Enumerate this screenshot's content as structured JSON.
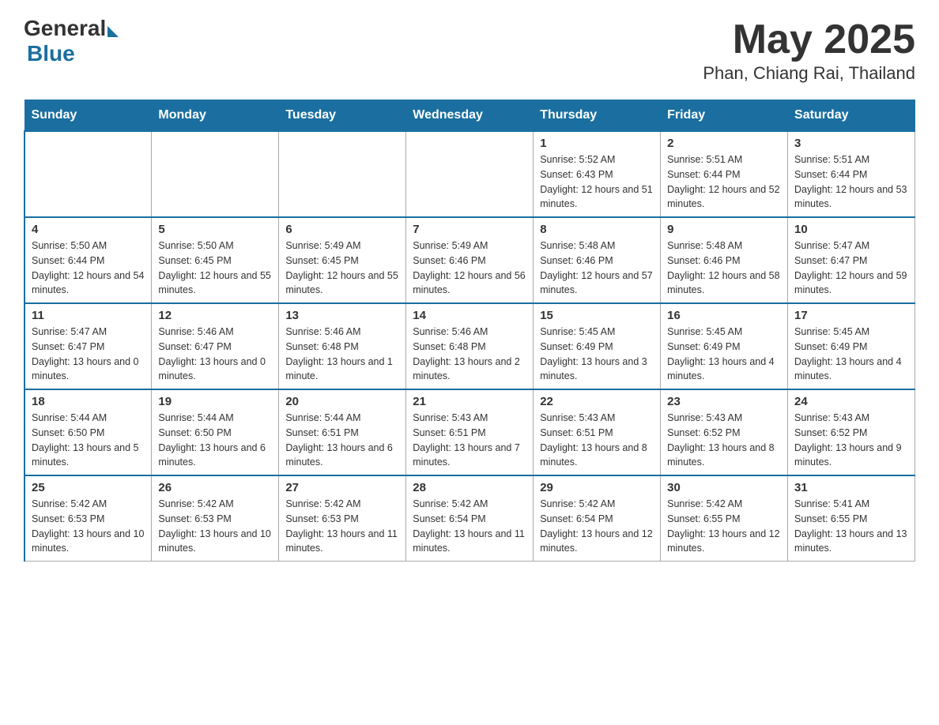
{
  "header": {
    "logo_general": "General",
    "logo_blue": "Blue",
    "month_year": "May 2025",
    "location": "Phan, Chiang Rai, Thailand"
  },
  "days_of_week": [
    "Sunday",
    "Monday",
    "Tuesday",
    "Wednesday",
    "Thursday",
    "Friday",
    "Saturday"
  ],
  "weeks": [
    [
      {
        "day": "",
        "info": ""
      },
      {
        "day": "",
        "info": ""
      },
      {
        "day": "",
        "info": ""
      },
      {
        "day": "",
        "info": ""
      },
      {
        "day": "1",
        "info": "Sunrise: 5:52 AM\nSunset: 6:43 PM\nDaylight: 12 hours and 51 minutes."
      },
      {
        "day": "2",
        "info": "Sunrise: 5:51 AM\nSunset: 6:44 PM\nDaylight: 12 hours and 52 minutes."
      },
      {
        "day": "3",
        "info": "Sunrise: 5:51 AM\nSunset: 6:44 PM\nDaylight: 12 hours and 53 minutes."
      }
    ],
    [
      {
        "day": "4",
        "info": "Sunrise: 5:50 AM\nSunset: 6:44 PM\nDaylight: 12 hours and 54 minutes."
      },
      {
        "day": "5",
        "info": "Sunrise: 5:50 AM\nSunset: 6:45 PM\nDaylight: 12 hours and 55 minutes."
      },
      {
        "day": "6",
        "info": "Sunrise: 5:49 AM\nSunset: 6:45 PM\nDaylight: 12 hours and 55 minutes."
      },
      {
        "day": "7",
        "info": "Sunrise: 5:49 AM\nSunset: 6:46 PM\nDaylight: 12 hours and 56 minutes."
      },
      {
        "day": "8",
        "info": "Sunrise: 5:48 AM\nSunset: 6:46 PM\nDaylight: 12 hours and 57 minutes."
      },
      {
        "day": "9",
        "info": "Sunrise: 5:48 AM\nSunset: 6:46 PM\nDaylight: 12 hours and 58 minutes."
      },
      {
        "day": "10",
        "info": "Sunrise: 5:47 AM\nSunset: 6:47 PM\nDaylight: 12 hours and 59 minutes."
      }
    ],
    [
      {
        "day": "11",
        "info": "Sunrise: 5:47 AM\nSunset: 6:47 PM\nDaylight: 13 hours and 0 minutes."
      },
      {
        "day": "12",
        "info": "Sunrise: 5:46 AM\nSunset: 6:47 PM\nDaylight: 13 hours and 0 minutes."
      },
      {
        "day": "13",
        "info": "Sunrise: 5:46 AM\nSunset: 6:48 PM\nDaylight: 13 hours and 1 minute."
      },
      {
        "day": "14",
        "info": "Sunrise: 5:46 AM\nSunset: 6:48 PM\nDaylight: 13 hours and 2 minutes."
      },
      {
        "day": "15",
        "info": "Sunrise: 5:45 AM\nSunset: 6:49 PM\nDaylight: 13 hours and 3 minutes."
      },
      {
        "day": "16",
        "info": "Sunrise: 5:45 AM\nSunset: 6:49 PM\nDaylight: 13 hours and 4 minutes."
      },
      {
        "day": "17",
        "info": "Sunrise: 5:45 AM\nSunset: 6:49 PM\nDaylight: 13 hours and 4 minutes."
      }
    ],
    [
      {
        "day": "18",
        "info": "Sunrise: 5:44 AM\nSunset: 6:50 PM\nDaylight: 13 hours and 5 minutes."
      },
      {
        "day": "19",
        "info": "Sunrise: 5:44 AM\nSunset: 6:50 PM\nDaylight: 13 hours and 6 minutes."
      },
      {
        "day": "20",
        "info": "Sunrise: 5:44 AM\nSunset: 6:51 PM\nDaylight: 13 hours and 6 minutes."
      },
      {
        "day": "21",
        "info": "Sunrise: 5:43 AM\nSunset: 6:51 PM\nDaylight: 13 hours and 7 minutes."
      },
      {
        "day": "22",
        "info": "Sunrise: 5:43 AM\nSunset: 6:51 PM\nDaylight: 13 hours and 8 minutes."
      },
      {
        "day": "23",
        "info": "Sunrise: 5:43 AM\nSunset: 6:52 PM\nDaylight: 13 hours and 8 minutes."
      },
      {
        "day": "24",
        "info": "Sunrise: 5:43 AM\nSunset: 6:52 PM\nDaylight: 13 hours and 9 minutes."
      }
    ],
    [
      {
        "day": "25",
        "info": "Sunrise: 5:42 AM\nSunset: 6:53 PM\nDaylight: 13 hours and 10 minutes."
      },
      {
        "day": "26",
        "info": "Sunrise: 5:42 AM\nSunset: 6:53 PM\nDaylight: 13 hours and 10 minutes."
      },
      {
        "day": "27",
        "info": "Sunrise: 5:42 AM\nSunset: 6:53 PM\nDaylight: 13 hours and 11 minutes."
      },
      {
        "day": "28",
        "info": "Sunrise: 5:42 AM\nSunset: 6:54 PM\nDaylight: 13 hours and 11 minutes."
      },
      {
        "day": "29",
        "info": "Sunrise: 5:42 AM\nSunset: 6:54 PM\nDaylight: 13 hours and 12 minutes."
      },
      {
        "day": "30",
        "info": "Sunrise: 5:42 AM\nSunset: 6:55 PM\nDaylight: 13 hours and 12 minutes."
      },
      {
        "day": "31",
        "info": "Sunrise: 5:41 AM\nSunset: 6:55 PM\nDaylight: 13 hours and 13 minutes."
      }
    ]
  ]
}
